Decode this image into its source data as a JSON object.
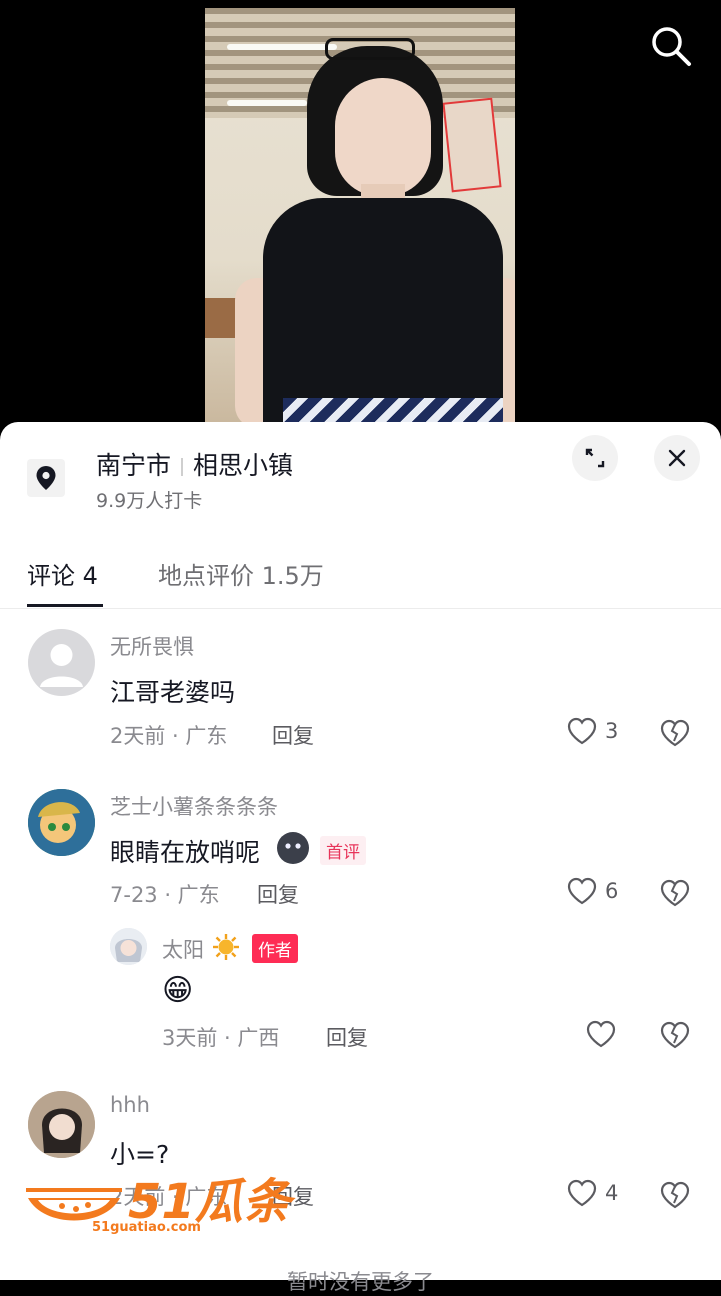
{
  "location": {
    "city": "南宁市",
    "place": "相思小镇",
    "checkins": "9.9万人打卡"
  },
  "tabs": [
    {
      "label": "评论 4",
      "active": true
    },
    {
      "label": "地点评价 1.5万",
      "active": false
    }
  ],
  "comments": [
    {
      "user": "无所畏惧",
      "text": "江哥老婆吗",
      "time_region": "2天前 · 广东",
      "reply_label": "回复",
      "likes": "3"
    },
    {
      "user": "芝士小薯条条条条",
      "text": "眼睛在放哨呢",
      "badge": "首评",
      "time_region": "7-23 · 广东",
      "reply_label": "回复",
      "likes": "6",
      "replies": [
        {
          "user": "太阳",
          "badge": "作者",
          "text": "😁",
          "time_region": "3天前 · 广西",
          "reply_label": "回复",
          "likes": ""
        }
      ]
    },
    {
      "user": "hhh",
      "text": "小=?",
      "time_region": "2天前 · 广东",
      "reply_label": "回复",
      "likes": "4"
    }
  ],
  "end_message": "暂时没有更多了",
  "watermark": {
    "brand": "51瓜条",
    "url": "51guatiao.com"
  },
  "colors": {
    "accent": "#fe2c55",
    "text": "#161823",
    "muted": "#8a8a8f",
    "watermark": "#f37a1e"
  }
}
